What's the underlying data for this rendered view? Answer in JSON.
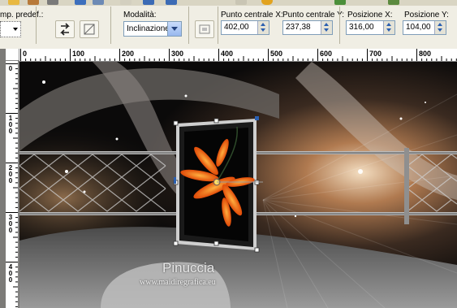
{
  "toolbar": {
    "preset_label": "mp. predef.:",
    "mode_label": "Modalità:",
    "mode_value": "Inclinazione",
    "center_x_label": "Punto centrale X:",
    "center_x_value": "402,00",
    "center_y_label": "Punto centrale Y:",
    "center_y_value": "237,38",
    "pos_x_label": "Posizione X:",
    "pos_x_value": "316,00",
    "pos_y_label": "Posizione Y:",
    "pos_y_value": "104,00"
  },
  "ruler": {
    "h_labels": [
      "0",
      "100",
      "200",
      "300",
      "400",
      "500",
      "600",
      "700",
      "800"
    ],
    "v_labels": [
      "0",
      "100",
      "200",
      "300",
      "400"
    ]
  },
  "watermark": {
    "name": "Pinuccia",
    "url": "www.maidiregrafica.eu"
  },
  "icons": [
    "copy-merged-icon",
    "flip-icon",
    "transform-reset-icon",
    "transform-apply-icon",
    "center-icon"
  ],
  "colors": {
    "toolbar_bg": "#f0eee4",
    "accent_blue": "#2a5fb0",
    "flower_orange": "#ff6a10",
    "frame_black": "#0a0a0a"
  }
}
